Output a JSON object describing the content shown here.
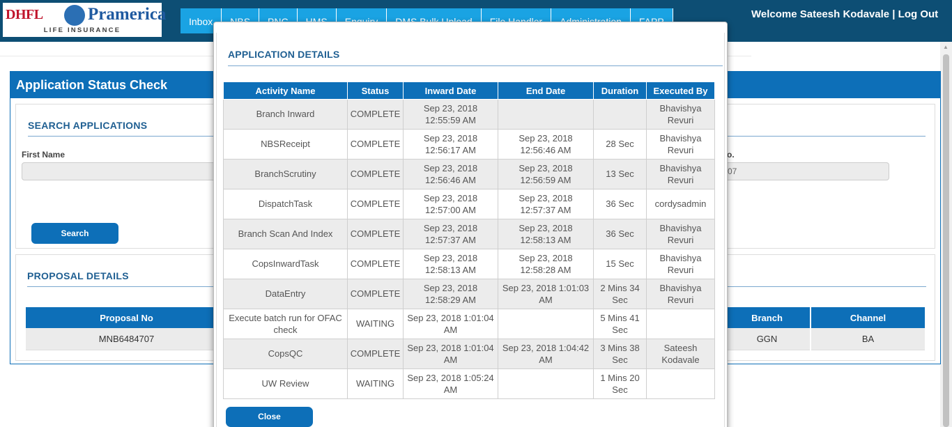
{
  "header": {
    "logo_dhfl": "DHFL",
    "logo_pramerica": "Pramerica",
    "logo_subtitle": "LIFE INSURANCE",
    "nav": [
      "Inbox",
      "NBS",
      "PNC",
      "HMS",
      "Enquiry",
      "DMS Bulk Upload",
      "File Handler",
      "Administration",
      "FAPP"
    ],
    "welcome": "Welcome Sateesh Kodavale | Log Out"
  },
  "page": {
    "title": "Application Status Check",
    "search": {
      "section_title": "SEARCH APPLICATIONS",
      "first_name_label": "First Name",
      "first_name_value": "",
      "right_label_fragment": "o.",
      "right_value_fragment": "07",
      "search_button": "Search"
    },
    "proposal": {
      "section_title": "PROPOSAL DETAILS",
      "columns": [
        "Proposal No",
        "Branch",
        "Channel"
      ],
      "row": [
        "MNB6484707",
        "GGN",
        "BA"
      ]
    }
  },
  "modal": {
    "title": "APPLICATION DETAILS",
    "columns": [
      "Activity Name",
      "Status",
      "Inward Date",
      "End Date",
      "Duration",
      "Executed By"
    ],
    "rows": [
      [
        "Branch Inward",
        "COMPLETE",
        "Sep 23, 2018 12:55:59 AM",
        "",
        "",
        "Bhavishya Revuri"
      ],
      [
        "NBSReceipt",
        "COMPLETE",
        "Sep 23, 2018 12:56:17 AM",
        "Sep 23, 2018 12:56:46 AM",
        "28 Sec",
        "Bhavishya Revuri"
      ],
      [
        "BranchScrutiny",
        "COMPLETE",
        "Sep 23, 2018 12:56:46 AM",
        "Sep 23, 2018 12:56:59 AM",
        "13 Sec",
        "Bhavishya Revuri"
      ],
      [
        "DispatchTask",
        "COMPLETE",
        "Sep 23, 2018 12:57:00 AM",
        "Sep 23, 2018 12:57:37 AM",
        "36 Sec",
        "cordysadmin"
      ],
      [
        "Branch Scan And Index",
        "COMPLETE",
        "Sep 23, 2018 12:57:37 AM",
        "Sep 23, 2018 12:58:13 AM",
        "36 Sec",
        "Bhavishya Revuri"
      ],
      [
        "CopsInwardTask",
        "COMPLETE",
        "Sep 23, 2018 12:58:13 AM",
        "Sep 23, 2018 12:58:28 AM",
        "15 Sec",
        "Bhavishya Revuri"
      ],
      [
        "DataEntry",
        "COMPLETE",
        "Sep 23, 2018 12:58:29 AM",
        "Sep 23, 2018 1:01:03 AM",
        "2 Mins 34 Sec",
        "Bhavishya Revuri"
      ],
      [
        "Execute batch run for OFAC check",
        "WAITING",
        "Sep 23, 2018 1:01:04 AM",
        "",
        "5 Mins 41 Sec",
        ""
      ],
      [
        "CopsQC",
        "COMPLETE",
        "Sep 23, 2018 1:01:04 AM",
        "Sep 23, 2018 1:04:42 AM",
        "3 Mins 38 Sec",
        "Sateesh Kodavale"
      ],
      [
        "UW Review",
        "WAITING",
        "Sep 23, 2018 1:05:24 AM",
        "",
        "1 Mins 20 Sec",
        ""
      ]
    ],
    "close_button": "Close"
  }
}
